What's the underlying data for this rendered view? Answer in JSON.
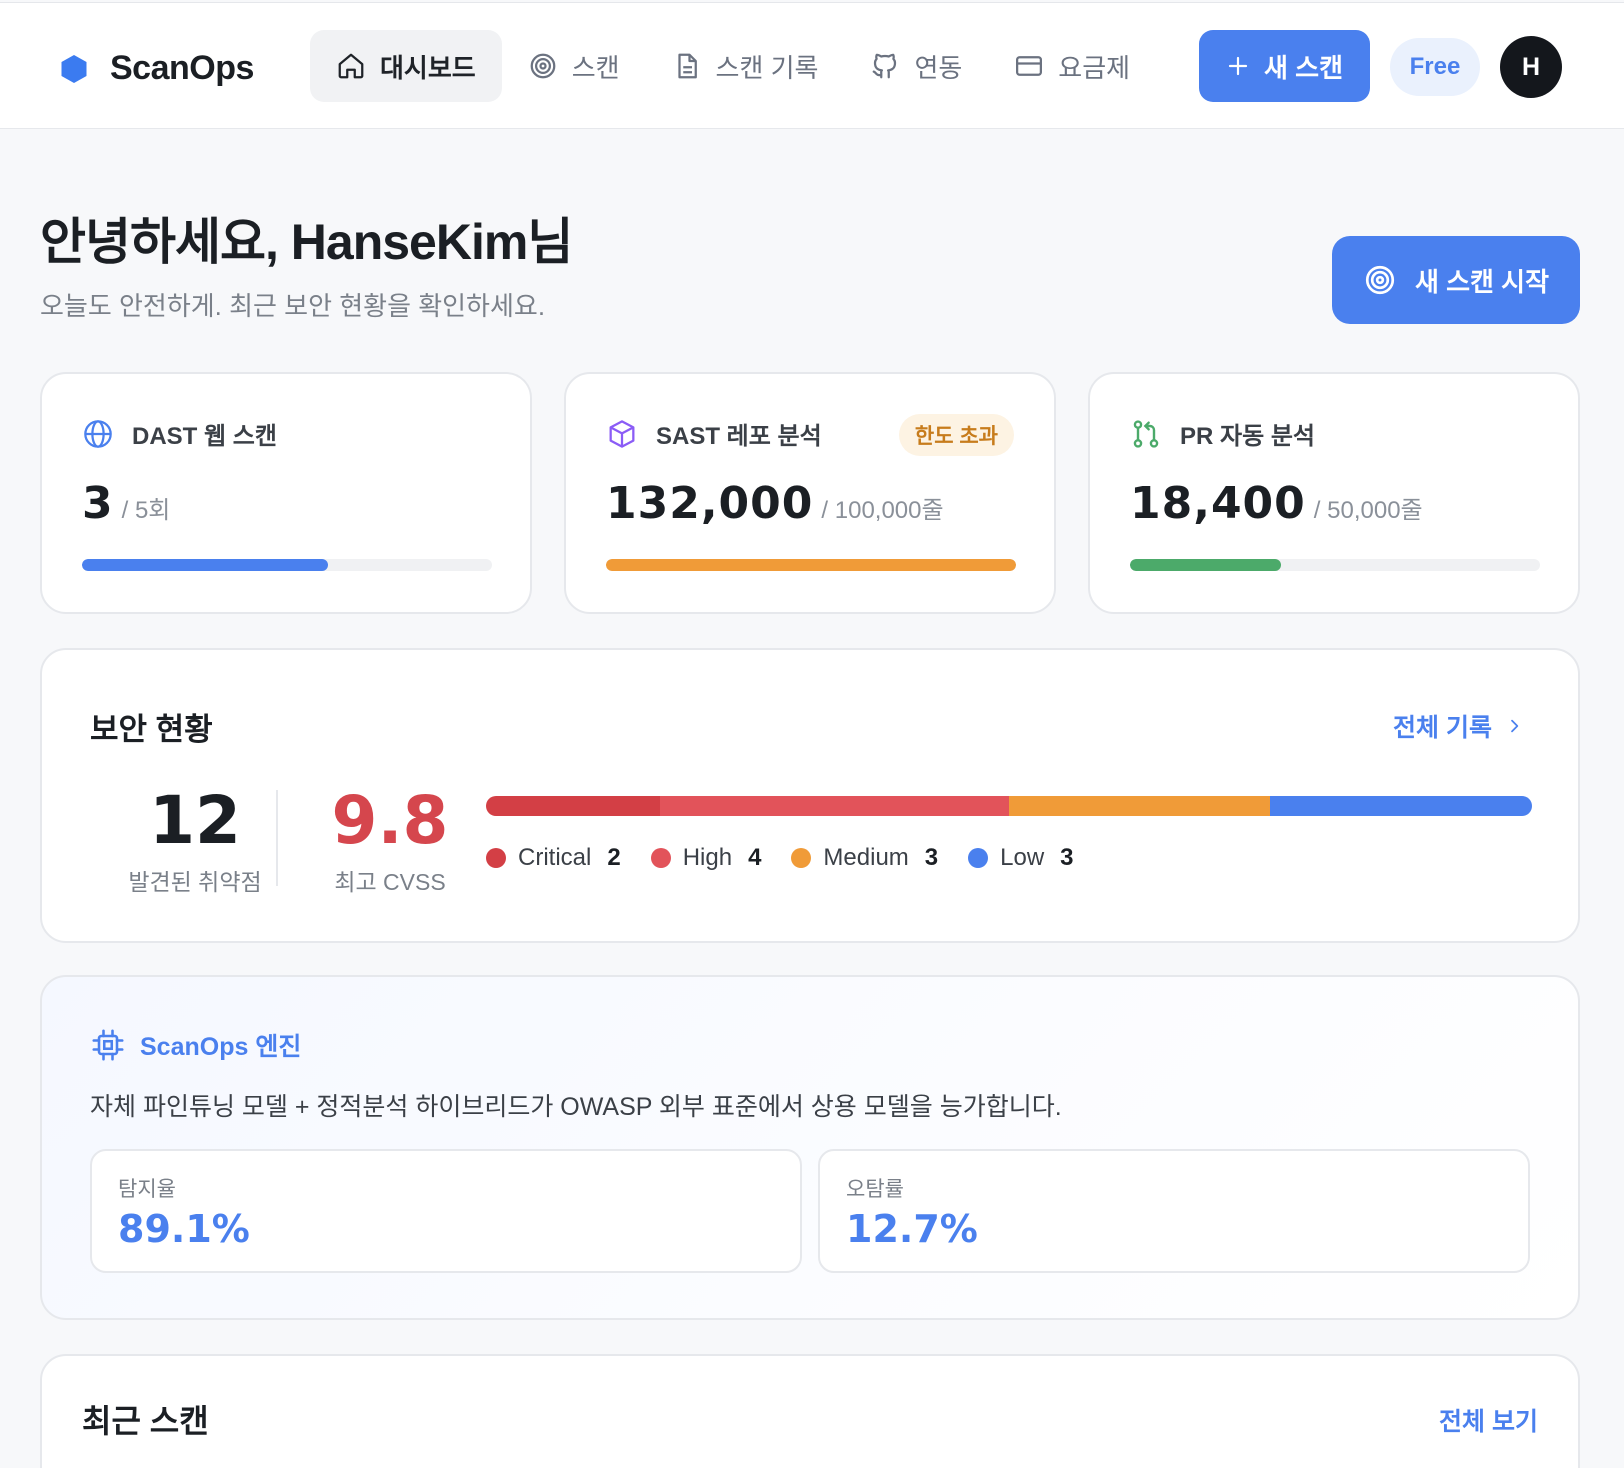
{
  "app": {
    "name": "ScanOps"
  },
  "nav": {
    "items": [
      {
        "label": "대시보드",
        "icon": "home-icon",
        "active": true
      },
      {
        "label": "스캔",
        "icon": "target-icon",
        "active": false
      },
      {
        "label": "스캔 기록",
        "icon": "document-icon",
        "active": false
      },
      {
        "label": "연동",
        "icon": "github-icon",
        "active": false
      },
      {
        "label": "요금제",
        "icon": "credit-card-icon",
        "active": false
      }
    ],
    "new_scan_label": "새 스캔",
    "plan_badge": "Free",
    "avatar_initial": "H"
  },
  "header": {
    "greeting": "안녕하세요, HanseKim님",
    "subtitle": "오늘도 안전하게. 최근 보안 현황을 확인하세요.",
    "start_scan_label": "새 스캔 시작"
  },
  "usage": [
    {
      "title": "DAST 웹 스캔",
      "icon": "globe-icon",
      "value": "3",
      "limit": "/ 5회",
      "progress": 0.6,
      "color": "#4a80ee",
      "badge": ""
    },
    {
      "title": "SAST 레포 분석",
      "icon": "box-icon",
      "value": "132,000",
      "limit": "/ 100,000줄",
      "progress": 1.0,
      "color": "#f09b38",
      "badge": "한도 초과"
    },
    {
      "title": "PR 자동 분석",
      "icon": "git-pull-request-icon",
      "value": "18,400",
      "limit": "/ 50,000줄",
      "progress": 0.368,
      "color": "#4caa6a",
      "badge": ""
    }
  ],
  "security": {
    "title": "보안 현황",
    "view_all": "전체 기록",
    "vuln_count": "12",
    "vuln_label": "발견된 취약점",
    "max_cvss": "9.8",
    "cvss_label": "최고 CVSS",
    "severities": [
      {
        "name": "Critical",
        "count": 2,
        "color": "#d33f45"
      },
      {
        "name": "High",
        "count": 4,
        "color": "#e2535a"
      },
      {
        "name": "Medium",
        "count": 3,
        "color": "#f09b38"
      },
      {
        "name": "Low",
        "count": 3,
        "color": "#4a80ee"
      }
    ]
  },
  "engine": {
    "title": "ScanOps 엔진",
    "description": "자체 파인튜닝 모델 + 정적분석 하이브리드가 OWASP 외부 표준에서 상용 모델을 능가합니다.",
    "metrics": [
      {
        "label": "탐지율",
        "value": "89.1%"
      },
      {
        "label": "오탐률",
        "value": "12.7%"
      }
    ]
  },
  "recent": {
    "title": "최근 스캔",
    "view_all": "전체 보기"
  }
}
